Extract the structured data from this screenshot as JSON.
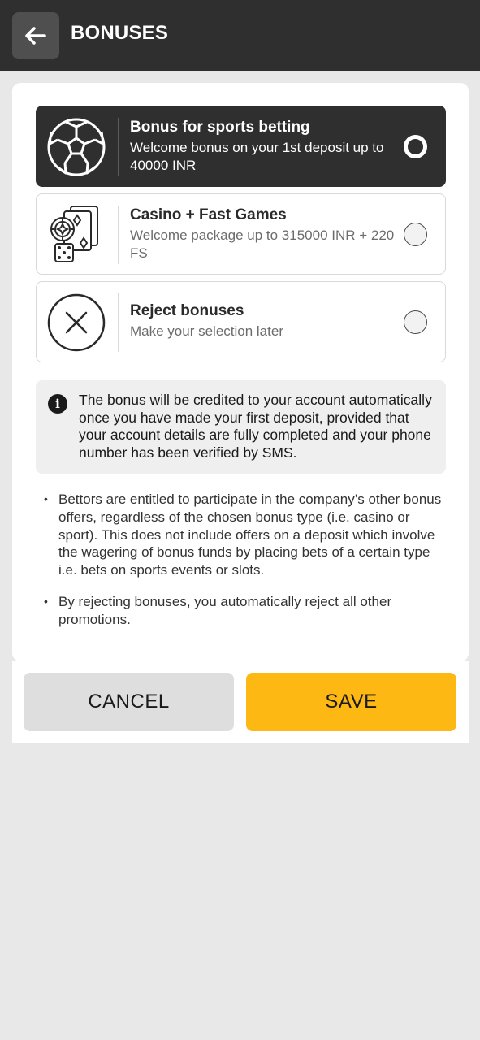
{
  "header": {
    "title": "BONUSES",
    "back_icon": "arrow-left-icon"
  },
  "options": [
    {
      "title": "Bonus for sports betting",
      "description": "Welcome bonus on your 1st deposit up to 40000 INR",
      "icon": "soccer-ball-icon",
      "selected": true
    },
    {
      "title": "Casino + Fast Games",
      "description": "Welcome package up to 315000 INR + 220 FS",
      "icon": "casino-cards-chip-dice-icon",
      "selected": false
    },
    {
      "title": "Reject bonuses",
      "description": "Make your selection later",
      "icon": "circle-x-icon",
      "selected": false
    }
  ],
  "info": {
    "icon": "info-icon",
    "text": "The bonus will be credited to your account automatically once you have made your first deposit, provided that your account details are fully completed and your phone number has been verified by SMS."
  },
  "notes": [
    "Bettors are entitled to participate in the company’s other bonus offers, regardless of the chosen bonus type (i.e. casino or sport). This does not include offers on a deposit which involve the wagering of bonus funds by placing bets of a certain type i.e. bets on sports events or slots.",
    "By rejecting bonuses, you automatically reject all other promotions."
  ],
  "buttons": {
    "cancel": "CANCEL",
    "save": "SAVE"
  },
  "colors": {
    "header_bg": "#2f2f2f",
    "selected_bg": "#2f2f2f",
    "save_bg": "#fdb813",
    "cancel_bg": "#dedede",
    "page_bg": "#e8e8e8"
  }
}
